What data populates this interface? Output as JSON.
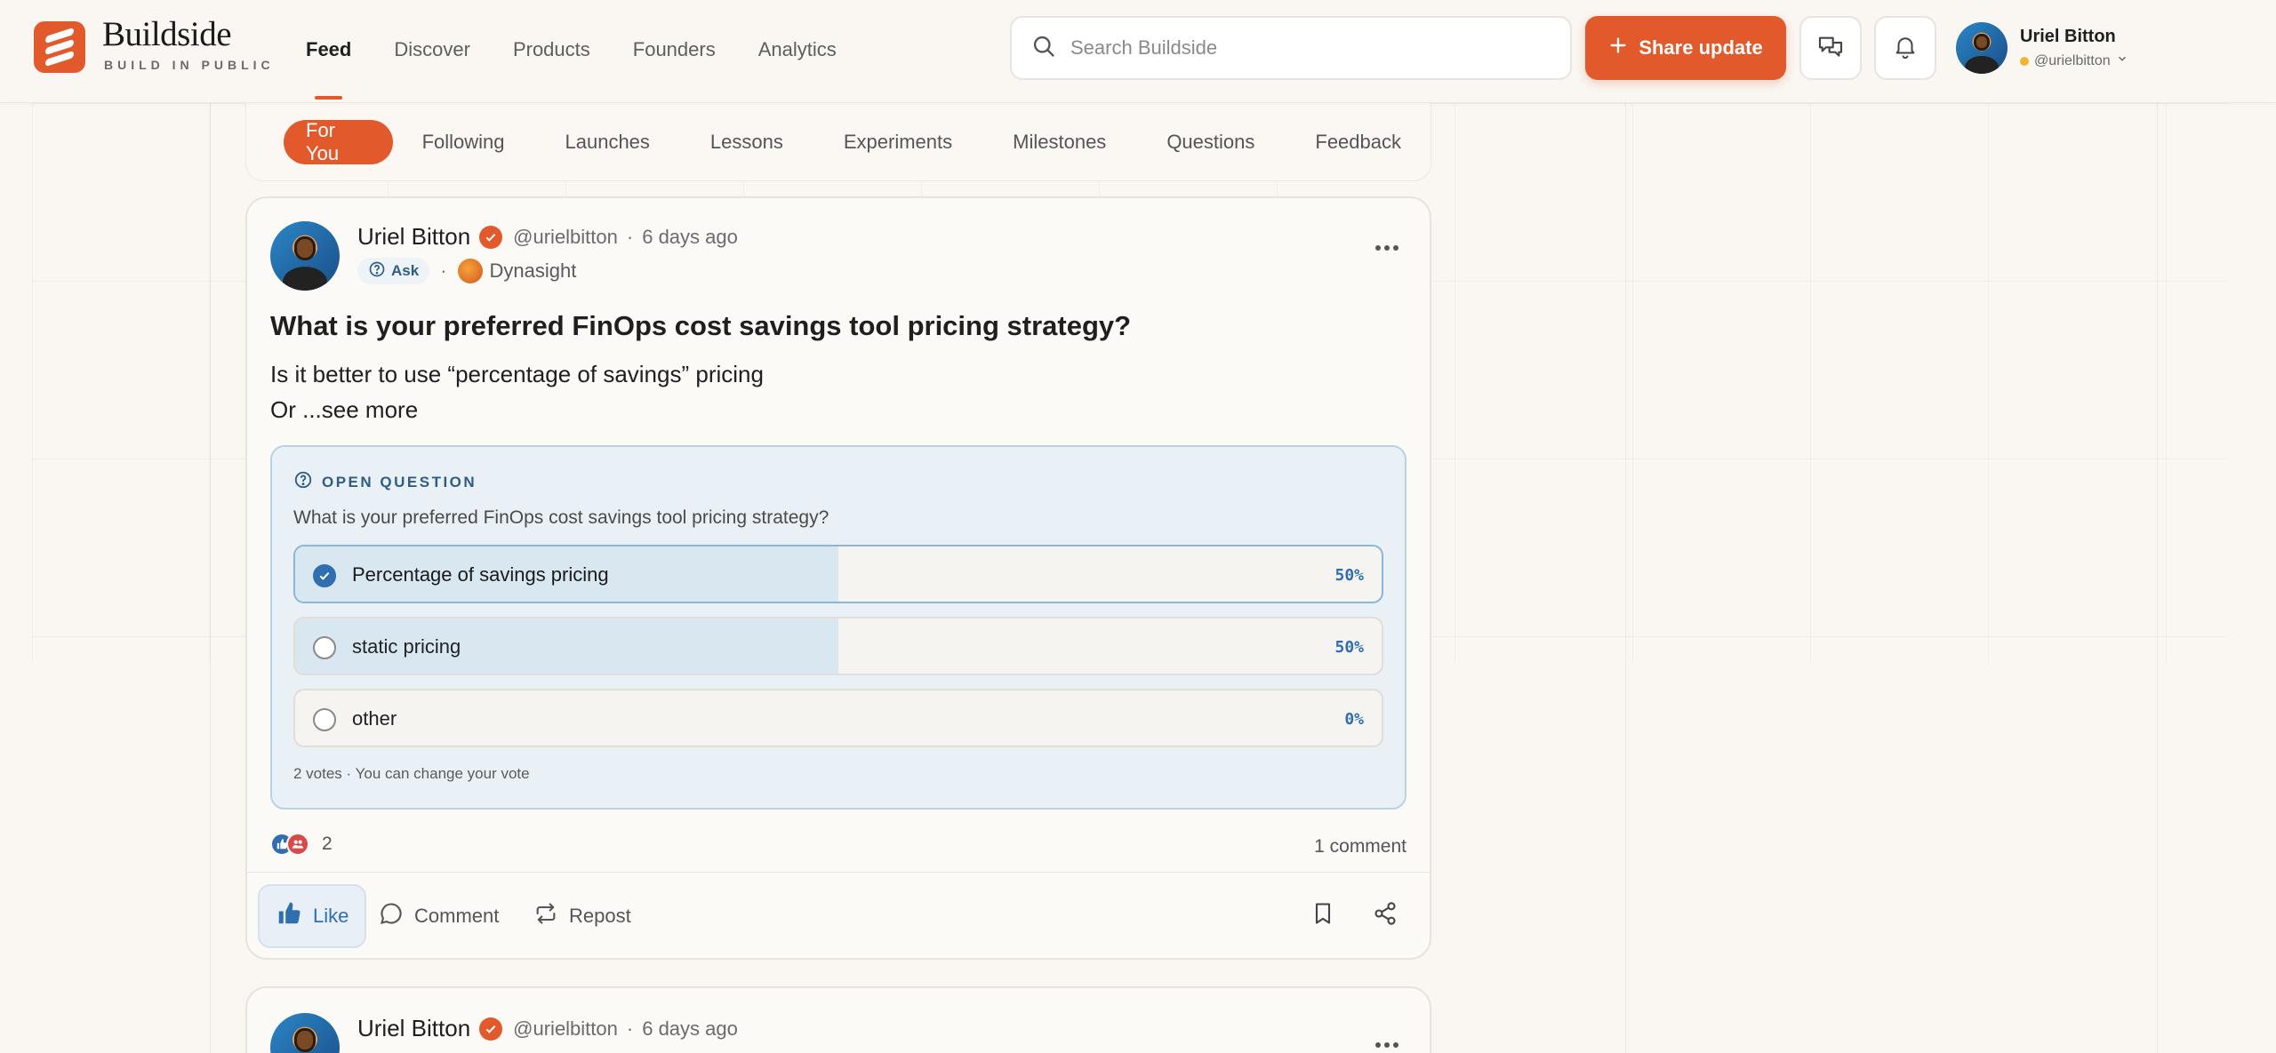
{
  "brand": {
    "name": "Buildside",
    "tagline": "BUILD IN PUBLIC",
    "accent": "#e2592c"
  },
  "nav": {
    "items": [
      "Feed",
      "Discover",
      "Products",
      "Founders",
      "Analytics"
    ],
    "active": "Feed"
  },
  "search": {
    "placeholder": "Search Buildside",
    "value": ""
  },
  "header": {
    "share_label": "Share update",
    "messages_icon": "chat-icon",
    "notifications_icon": "bell-icon"
  },
  "user": {
    "name": "Uriel Bitton",
    "handle": "@urielbitton",
    "status_color": "#f2b431"
  },
  "filters": {
    "items": [
      "For You",
      "Following",
      "Launches",
      "Lessons",
      "Experiments",
      "Milestones",
      "Questions",
      "Feedback"
    ],
    "active": "For You"
  },
  "post": {
    "author": "Uriel Bitton",
    "handle": "@urielbitton",
    "separator": "·",
    "time": "6 days ago",
    "type_label": "Ask",
    "project": "Dynasight",
    "title": "What is your preferred FinOps cost savings tool pricing strategy?",
    "body_line1": "Is it better to use “percentage of savings” pricing",
    "body_line2": "Or ...see more",
    "poll": {
      "label": "OPEN QUESTION",
      "question": "What is your preferred FinOps cost savings tool pricing strategy?",
      "options": [
        {
          "text": "Percentage of savings pricing",
          "percent_label": "50%",
          "share": 0.5,
          "selected": true
        },
        {
          "text": "static pricing",
          "percent_label": "50%",
          "share": 0.5,
          "selected": false
        },
        {
          "text": "other",
          "percent_label": "0%",
          "share": 0,
          "selected": false
        }
      ],
      "footer": "2 votes · You can change your vote"
    },
    "reactions_count": "2",
    "comments_label": "1 comment",
    "actions": {
      "like": "Like",
      "comment": "Comment",
      "repost": "Repost"
    }
  },
  "post2": {
    "author": "Uriel Bitton",
    "handle": "@urielbitton",
    "separator": "·",
    "time": "6 days ago"
  }
}
